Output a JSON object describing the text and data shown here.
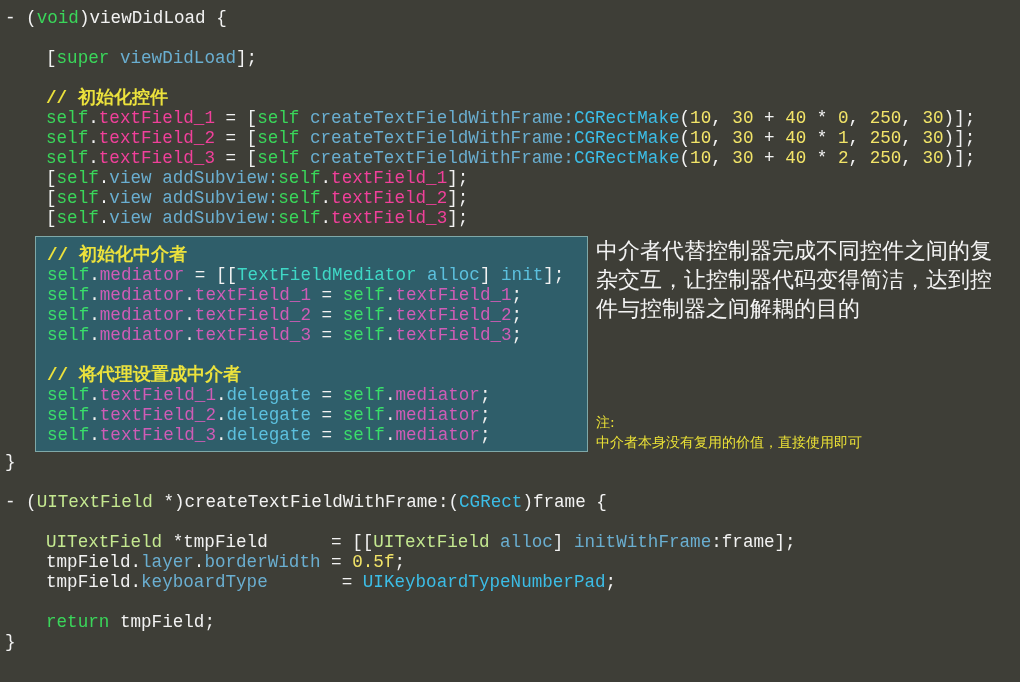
{
  "method_1": {
    "header": [
      {
        "kind": "plain",
        "text": "- ("
      },
      {
        "kind": "keyword",
        "text": "void"
      },
      {
        "kind": "plain",
        "text": ")viewDidLoad {"
      }
    ],
    "body": [
      {
        "kind": "blank"
      },
      {
        "kind": "code",
        "tokens": [
          {
            "kind": "plain",
            "text": "["
          },
          {
            "kind": "keyword",
            "text": "super "
          },
          {
            "kind": "method",
            "text": "viewDidLoad"
          },
          {
            "kind": "plain",
            "text": "];"
          }
        ]
      },
      {
        "kind": "blank"
      },
      {
        "kind": "code",
        "tokens": [
          {
            "kind": "comment",
            "text": "// 初始化控件"
          }
        ]
      },
      {
        "kind": "code",
        "tokens": [
          {
            "kind": "keyword",
            "text": "self"
          },
          {
            "kind": "plain",
            "text": "."
          },
          {
            "kind": "property",
            "text": "textField_1"
          },
          {
            "kind": "plain",
            "text": " = ["
          },
          {
            "kind": "keyword",
            "text": "self "
          },
          {
            "kind": "method",
            "text": "createTextFieldWithFrame:"
          },
          {
            "kind": "func",
            "text": "CGRectMake"
          },
          {
            "kind": "plain",
            "text": "("
          },
          {
            "kind": "number",
            "text": "10"
          },
          {
            "kind": "plain",
            "text": ", "
          },
          {
            "kind": "number",
            "text": "30"
          },
          {
            "kind": "plain",
            "text": " + "
          },
          {
            "kind": "number",
            "text": "40"
          },
          {
            "kind": "plain",
            "text": " * "
          },
          {
            "kind": "number",
            "text": "0"
          },
          {
            "kind": "plain",
            "text": ", "
          },
          {
            "kind": "number",
            "text": "250"
          },
          {
            "kind": "plain",
            "text": ", "
          },
          {
            "kind": "number",
            "text": "30"
          },
          {
            "kind": "plain",
            "text": ")];"
          }
        ]
      },
      {
        "kind": "code",
        "tokens": [
          {
            "kind": "keyword",
            "text": "self"
          },
          {
            "kind": "plain",
            "text": "."
          },
          {
            "kind": "property",
            "text": "textField_2"
          },
          {
            "kind": "plain",
            "text": " = ["
          },
          {
            "kind": "keyword",
            "text": "self "
          },
          {
            "kind": "method",
            "text": "createTextFieldWithFrame:"
          },
          {
            "kind": "func",
            "text": "CGRectMake"
          },
          {
            "kind": "plain",
            "text": "("
          },
          {
            "kind": "number",
            "text": "10"
          },
          {
            "kind": "plain",
            "text": ", "
          },
          {
            "kind": "number",
            "text": "30"
          },
          {
            "kind": "plain",
            "text": " + "
          },
          {
            "kind": "number",
            "text": "40"
          },
          {
            "kind": "plain",
            "text": " * "
          },
          {
            "kind": "number",
            "text": "1"
          },
          {
            "kind": "plain",
            "text": ", "
          },
          {
            "kind": "number",
            "text": "250"
          },
          {
            "kind": "plain",
            "text": ", "
          },
          {
            "kind": "number",
            "text": "30"
          },
          {
            "kind": "plain",
            "text": ")];"
          }
        ]
      },
      {
        "kind": "code",
        "tokens": [
          {
            "kind": "keyword",
            "text": "self"
          },
          {
            "kind": "plain",
            "text": "."
          },
          {
            "kind": "property",
            "text": "textField_3"
          },
          {
            "kind": "plain",
            "text": " = ["
          },
          {
            "kind": "keyword",
            "text": "self "
          },
          {
            "kind": "method",
            "text": "createTextFieldWithFrame:"
          },
          {
            "kind": "func",
            "text": "CGRectMake"
          },
          {
            "kind": "plain",
            "text": "("
          },
          {
            "kind": "number",
            "text": "10"
          },
          {
            "kind": "plain",
            "text": ", "
          },
          {
            "kind": "number",
            "text": "30"
          },
          {
            "kind": "plain",
            "text": " + "
          },
          {
            "kind": "number",
            "text": "40"
          },
          {
            "kind": "plain",
            "text": " * "
          },
          {
            "kind": "number",
            "text": "2"
          },
          {
            "kind": "plain",
            "text": ", "
          },
          {
            "kind": "number",
            "text": "250"
          },
          {
            "kind": "plain",
            "text": ", "
          },
          {
            "kind": "number",
            "text": "30"
          },
          {
            "kind": "plain",
            "text": ")];"
          }
        ]
      },
      {
        "kind": "code",
        "tokens": [
          {
            "kind": "plain",
            "text": "["
          },
          {
            "kind": "keyword",
            "text": "self"
          },
          {
            "kind": "plain",
            "text": "."
          },
          {
            "kind": "method",
            "text": "view "
          },
          {
            "kind": "method",
            "text": "addSubview:"
          },
          {
            "kind": "keyword",
            "text": "self"
          },
          {
            "kind": "plain",
            "text": "."
          },
          {
            "kind": "property",
            "text": "textField_1"
          },
          {
            "kind": "plain",
            "text": "];"
          }
        ]
      },
      {
        "kind": "code",
        "tokens": [
          {
            "kind": "plain",
            "text": "["
          },
          {
            "kind": "keyword",
            "text": "self"
          },
          {
            "kind": "plain",
            "text": "."
          },
          {
            "kind": "method",
            "text": "view "
          },
          {
            "kind": "method",
            "text": "addSubview:"
          },
          {
            "kind": "keyword",
            "text": "self"
          },
          {
            "kind": "plain",
            "text": "."
          },
          {
            "kind": "property",
            "text": "textField_2"
          },
          {
            "kind": "plain",
            "text": "];"
          }
        ]
      },
      {
        "kind": "code",
        "tokens": [
          {
            "kind": "plain",
            "text": "["
          },
          {
            "kind": "keyword",
            "text": "self"
          },
          {
            "kind": "plain",
            "text": "."
          },
          {
            "kind": "method",
            "text": "view "
          },
          {
            "kind": "method",
            "text": "addSubview:"
          },
          {
            "kind": "keyword",
            "text": "self"
          },
          {
            "kind": "plain",
            "text": "."
          },
          {
            "kind": "property",
            "text": "textField_3"
          },
          {
            "kind": "plain",
            "text": "];"
          }
        ]
      }
    ],
    "highlight_block": [
      {
        "kind": "code",
        "tokens": [
          {
            "kind": "comment",
            "text": "// 初始化中介者"
          }
        ]
      },
      {
        "kind": "code",
        "tokens": [
          {
            "kind": "keyword",
            "text": "self"
          },
          {
            "kind": "plain",
            "text": "."
          },
          {
            "kind": "property",
            "text": "mediator"
          },
          {
            "kind": "plain",
            "text": " = [["
          },
          {
            "kind": "class",
            "text": "TextFieldMediator "
          },
          {
            "kind": "method",
            "text": "alloc"
          },
          {
            "kind": "plain",
            "text": "] "
          },
          {
            "kind": "method",
            "text": "init"
          },
          {
            "kind": "plain",
            "text": "];"
          }
        ]
      },
      {
        "kind": "code",
        "tokens": [
          {
            "kind": "keyword",
            "text": "self"
          },
          {
            "kind": "plain",
            "text": "."
          },
          {
            "kind": "property",
            "text": "mediator"
          },
          {
            "kind": "plain",
            "text": "."
          },
          {
            "kind": "property",
            "text": "textField_1"
          },
          {
            "kind": "plain",
            "text": " = "
          },
          {
            "kind": "keyword",
            "text": "self"
          },
          {
            "kind": "plain",
            "text": "."
          },
          {
            "kind": "property",
            "text": "textField_1"
          },
          {
            "kind": "plain",
            "text": ";"
          }
        ]
      },
      {
        "kind": "code",
        "tokens": [
          {
            "kind": "keyword",
            "text": "self"
          },
          {
            "kind": "plain",
            "text": "."
          },
          {
            "kind": "property",
            "text": "mediator"
          },
          {
            "kind": "plain",
            "text": "."
          },
          {
            "kind": "property",
            "text": "textField_2"
          },
          {
            "kind": "plain",
            "text": " = "
          },
          {
            "kind": "keyword",
            "text": "self"
          },
          {
            "kind": "plain",
            "text": "."
          },
          {
            "kind": "property",
            "text": "textField_2"
          },
          {
            "kind": "plain",
            "text": ";"
          }
        ]
      },
      {
        "kind": "code",
        "tokens": [
          {
            "kind": "keyword",
            "text": "self"
          },
          {
            "kind": "plain",
            "text": "."
          },
          {
            "kind": "property",
            "text": "mediator"
          },
          {
            "kind": "plain",
            "text": "."
          },
          {
            "kind": "property",
            "text": "textField_3"
          },
          {
            "kind": "plain",
            "text": " = "
          },
          {
            "kind": "keyword",
            "text": "self"
          },
          {
            "kind": "plain",
            "text": "."
          },
          {
            "kind": "property",
            "text": "textField_3"
          },
          {
            "kind": "plain",
            "text": ";"
          }
        ]
      },
      {
        "kind": "blank"
      },
      {
        "kind": "code",
        "tokens": [
          {
            "kind": "comment",
            "text": "// 将代理设置成中介者"
          }
        ]
      },
      {
        "kind": "code",
        "tokens": [
          {
            "kind": "keyword",
            "text": "self"
          },
          {
            "kind": "plain",
            "text": "."
          },
          {
            "kind": "property",
            "text": "textField_1"
          },
          {
            "kind": "plain",
            "text": "."
          },
          {
            "kind": "method",
            "text": "delegate"
          },
          {
            "kind": "plain",
            "text": " = "
          },
          {
            "kind": "keyword",
            "text": "self"
          },
          {
            "kind": "plain",
            "text": "."
          },
          {
            "kind": "property",
            "text": "mediator"
          },
          {
            "kind": "plain",
            "text": ";"
          }
        ]
      },
      {
        "kind": "code",
        "tokens": [
          {
            "kind": "keyword",
            "text": "self"
          },
          {
            "kind": "plain",
            "text": "."
          },
          {
            "kind": "property",
            "text": "textField_2"
          },
          {
            "kind": "plain",
            "text": "."
          },
          {
            "kind": "method",
            "text": "delegate"
          },
          {
            "kind": "plain",
            "text": " = "
          },
          {
            "kind": "keyword",
            "text": "self"
          },
          {
            "kind": "plain",
            "text": "."
          },
          {
            "kind": "property",
            "text": "mediator"
          },
          {
            "kind": "plain",
            "text": ";"
          }
        ]
      },
      {
        "kind": "code",
        "tokens": [
          {
            "kind": "keyword",
            "text": "self"
          },
          {
            "kind": "plain",
            "text": "."
          },
          {
            "kind": "property",
            "text": "textField_3"
          },
          {
            "kind": "plain",
            "text": "."
          },
          {
            "kind": "method",
            "text": "delegate"
          },
          {
            "kind": "plain",
            "text": " = "
          },
          {
            "kind": "keyword",
            "text": "self"
          },
          {
            "kind": "plain",
            "text": "."
          },
          {
            "kind": "property",
            "text": "mediator"
          },
          {
            "kind": "plain",
            "text": ";"
          }
        ]
      }
    ],
    "closing": "}"
  },
  "annotation": {
    "text": "中介者代替控制器完成不同控件之间的复杂交互，让控制器代码变得简洁，达到控件与控制器之间解耦的目的",
    "note_label": "注:",
    "note_text": "中介者本身没有复用的价值，直接使用即可"
  },
  "method_2": {
    "header": [
      {
        "kind": "plain",
        "text": "- ("
      },
      {
        "kind": "type",
        "text": "UITextField"
      },
      {
        "kind": "plain",
        "text": " *)createTextFieldWithFrame:("
      },
      {
        "kind": "func",
        "text": "CGRect"
      },
      {
        "kind": "plain",
        "text": ")frame {"
      }
    ],
    "body": [
      {
        "kind": "blank"
      },
      {
        "kind": "code",
        "tokens": [
          {
            "kind": "type",
            "text": "UITextField"
          },
          {
            "kind": "plain",
            "text": " *tmpField      = [["
          },
          {
            "kind": "type",
            "text": "UITextField "
          },
          {
            "kind": "method",
            "text": "alloc"
          },
          {
            "kind": "plain",
            "text": "] "
          },
          {
            "kind": "method",
            "text": "initWithFrame"
          },
          {
            "kind": "plain",
            "text": ":frame];"
          }
        ]
      },
      {
        "kind": "code",
        "tokens": [
          {
            "kind": "plain",
            "text": "tmpField."
          },
          {
            "kind": "method",
            "text": "layer"
          },
          {
            "kind": "plain",
            "text": "."
          },
          {
            "kind": "method",
            "text": "borderWidth"
          },
          {
            "kind": "plain",
            "text": " = "
          },
          {
            "kind": "number",
            "text": "0.5f"
          },
          {
            "kind": "plain",
            "text": ";"
          }
        ]
      },
      {
        "kind": "code",
        "tokens": [
          {
            "kind": "plain",
            "text": "tmpField."
          },
          {
            "kind": "method",
            "text": "keyboardType"
          },
          {
            "kind": "plain",
            "text": "       = "
          },
          {
            "kind": "func",
            "text": "UIKeyboardTypeNumberPad"
          },
          {
            "kind": "plain",
            "text": ";"
          }
        ]
      },
      {
        "kind": "blank"
      },
      {
        "kind": "code",
        "tokens": [
          {
            "kind": "keyword",
            "text": "return"
          },
          {
            "kind": "plain",
            "text": " tmpField;"
          }
        ]
      }
    ],
    "closing": "}"
  }
}
